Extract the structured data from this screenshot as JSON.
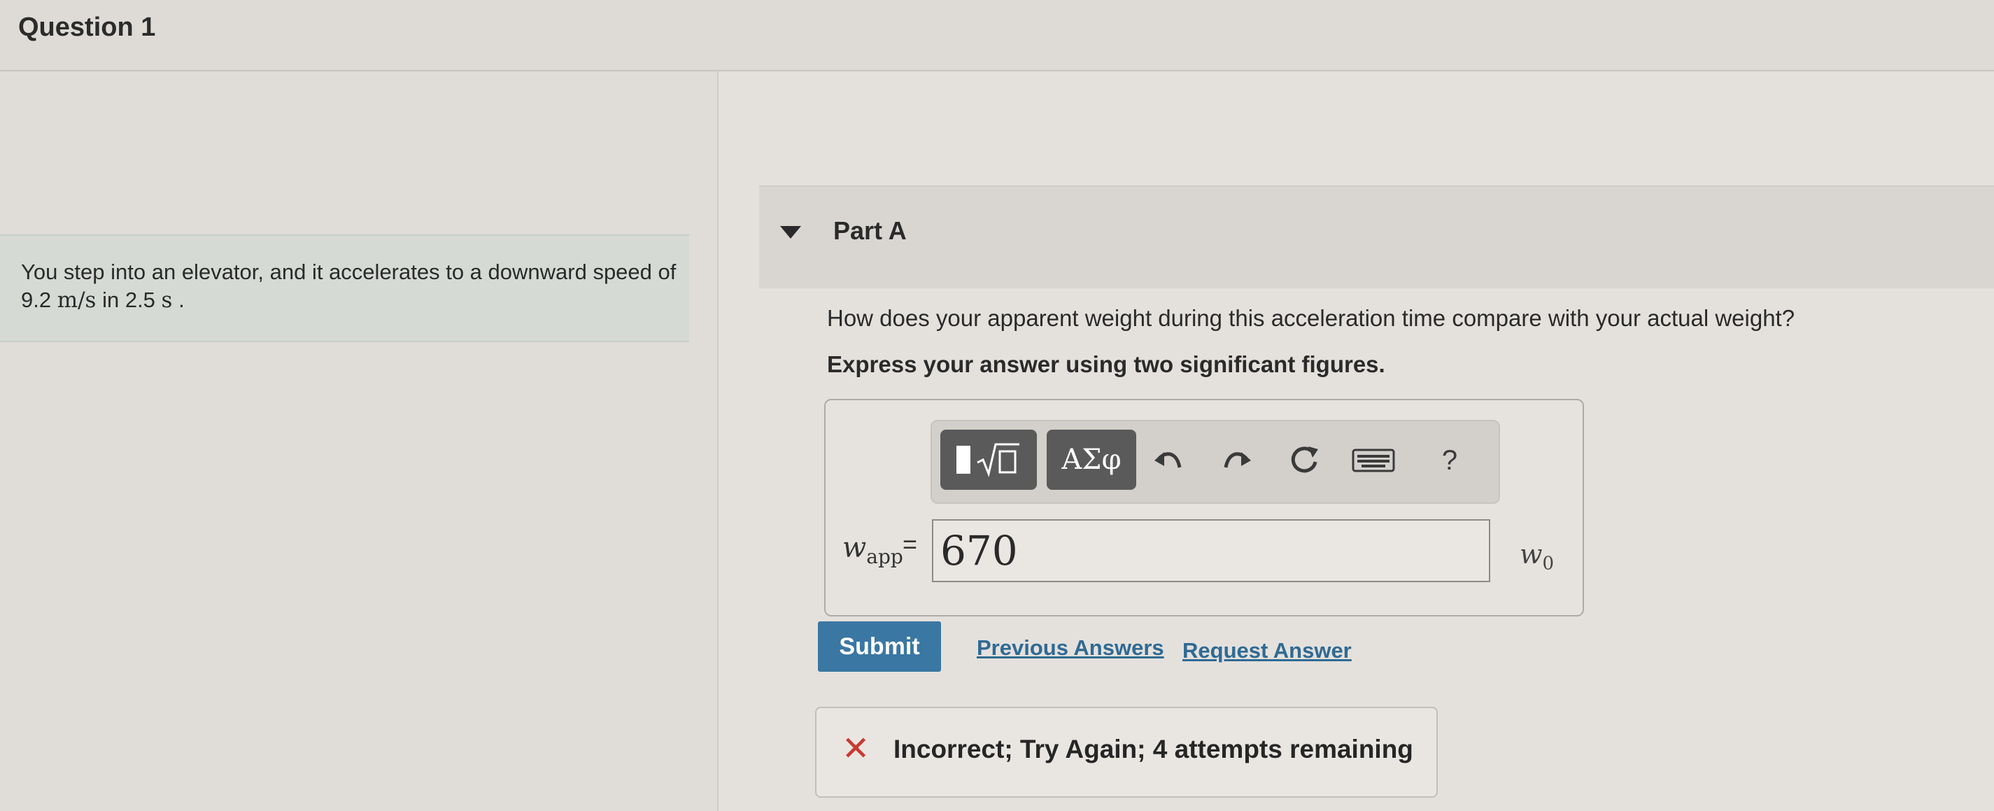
{
  "question": {
    "title": "Question 1"
  },
  "problem": {
    "text_prefix": "You step into an elevator, and it accelerates to a downward speed of 9.2 ",
    "unit_speed": "m/s",
    "text_mid": " in 2.5 ",
    "unit_time": "s",
    "text_suffix": " ."
  },
  "part": {
    "title": "Part A"
  },
  "prompt": {
    "question": "How does your apparent weight during this acceleration time compare with your actual weight?",
    "instruction": "Express your answer using two significant figures."
  },
  "toolbar": {
    "templates_icon": "sqrt-template-icon",
    "greek_label": "ΑΣφ",
    "undo_icon": "undo-icon",
    "redo_icon": "redo-icon",
    "reset_icon": "reset-icon",
    "keyboard_icon": "keyboard-icon",
    "help_label": "?"
  },
  "answer": {
    "variable": "w",
    "variable_sub": "app",
    "equals": "=",
    "value": "670",
    "unit": "w",
    "unit_sub": "0"
  },
  "actions": {
    "submit": "Submit",
    "previous_answers": "Previous Answers",
    "request_answer": "Request Answer"
  },
  "feedback": {
    "icon": "x-icon",
    "message": "Incorrect; Try Again; 4 attempts remaining"
  },
  "colors": {
    "submit_bg": "#3a77a3",
    "link": "#2f6a93",
    "error": "#c93a32",
    "problem_bg": "#d5dad5"
  }
}
